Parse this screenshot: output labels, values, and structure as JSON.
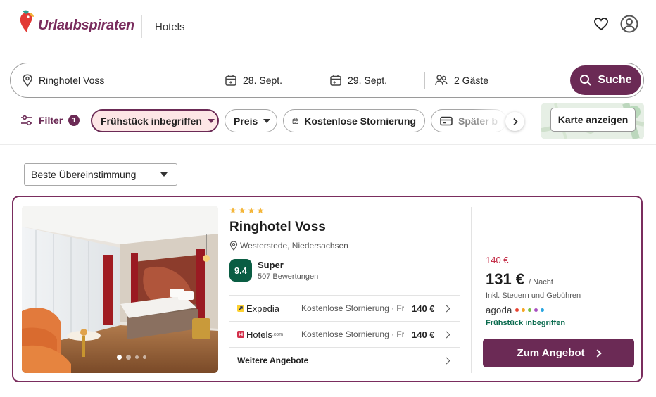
{
  "header": {
    "brand": "Urlaubspiraten",
    "section": "Hotels"
  },
  "search": {
    "location": "Ringhotel Voss",
    "checkin": "28. Sept.",
    "checkout": "29. Sept.",
    "guests": "2 Gäste",
    "button": "Suche"
  },
  "filters": {
    "label": "Filter",
    "count": "1",
    "chips": [
      "Frühstück inbegriffen",
      "Preis",
      "Kostenlose Stornierung",
      "Später b"
    ],
    "map_button": "Karte anzeigen"
  },
  "sort": {
    "selected": "Beste Übereinstimmung"
  },
  "hotel": {
    "stars": 4,
    "name": "Ringhotel Voss",
    "location": "Westerstede, Niedersachsen",
    "rating": "9.4",
    "rating_label": "Super",
    "reviews": "507 Bewertungen",
    "offers": [
      {
        "provider": "Expedia",
        "condition": "Kostenlose Stornierung · Frühstück",
        "price": "140 €"
      },
      {
        "provider": "Hotels",
        "provider_suffix": ".com",
        "condition": "Kostenlose Stornierung · Frühstück",
        "price": "140 €"
      }
    ],
    "more_offers": "Weitere Angebote",
    "old_price": "140 €",
    "price": "131 €",
    "per_night": "/ Nacht",
    "tax_note": "Inkl. Steuern und Gebühren",
    "best_provider": "agoda",
    "breakfast": "Frühstück inbegriffen",
    "cta": "Zum Angebot",
    "photo_index": 1,
    "photo_count": 4
  },
  "colors": {
    "brand": "#6b2a55",
    "score": "#0a5d43",
    "old_price": "#c0213c",
    "active_chip_bg": "#fde6e6"
  }
}
